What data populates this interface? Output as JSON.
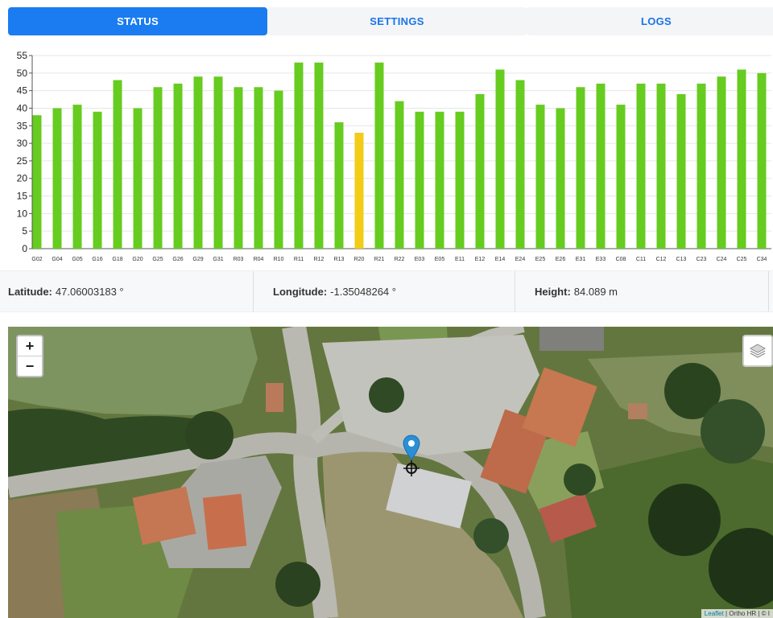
{
  "tabs": [
    {
      "label": "STATUS",
      "active": true
    },
    {
      "label": "SETTINGS",
      "active": false
    },
    {
      "label": "LOGS",
      "active": false
    }
  ],
  "colors": {
    "accent": "#1a7cf0",
    "bar_good": "#66cc1f",
    "bar_warn": "#f2cc17",
    "grid": "#e6e6e6"
  },
  "chart_data": {
    "type": "bar",
    "title": "",
    "xlabel": "",
    "ylabel": "",
    "ylim": [
      0,
      55
    ],
    "yticks": [
      0,
      5,
      10,
      15,
      20,
      25,
      30,
      35,
      40,
      45,
      50,
      55
    ],
    "grid": true,
    "categories": [
      "G02",
      "G04",
      "G05",
      "G16",
      "G18",
      "G20",
      "G25",
      "G26",
      "G29",
      "G31",
      "R03",
      "R04",
      "R10",
      "R11",
      "R12",
      "R13",
      "R20",
      "R21",
      "R22",
      "E03",
      "E05",
      "E11",
      "E12",
      "E14",
      "E24",
      "E25",
      "E26",
      "E31",
      "E33",
      "C08",
      "C11",
      "C12",
      "C13",
      "C23",
      "C24",
      "C25",
      "C34"
    ],
    "values": [
      38,
      40,
      41,
      39,
      48,
      40,
      46,
      47,
      49,
      49,
      46,
      46,
      45,
      53,
      53,
      36,
      33,
      53,
      42,
      39,
      39,
      39,
      44,
      51,
      48,
      41,
      40,
      46,
      47,
      41,
      47,
      47,
      44,
      47,
      49,
      51,
      50
    ],
    "highlight_index": 16
  },
  "position": {
    "latitude_label": "Latitude:",
    "latitude_value": "47.06003183 °",
    "longitude_label": "Longitude:",
    "longitude_value": "-1.35048264 °",
    "height_label": "Height:",
    "height_value": "84.089 m"
  },
  "map": {
    "zoom_in": "+",
    "zoom_out": "−",
    "attribution_link": "Leaflet",
    "attribution_text": " | Ortho HR | © I"
  }
}
